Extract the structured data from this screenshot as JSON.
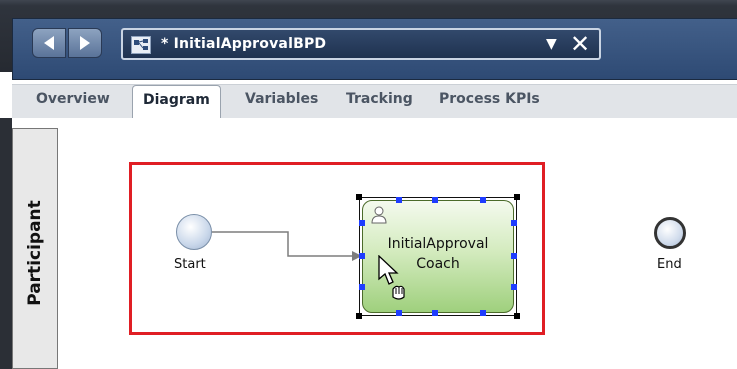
{
  "window": {
    "title": "* InitialApprovalBPD",
    "dropdown_glyph": "▼",
    "close_glyph": "✕",
    "back_icon": "left-arrow-icon",
    "forward_icon": "right-arrow-icon",
    "doc_icon": "process-diagram-icon"
  },
  "tabs": [
    {
      "label": "Overview",
      "active": false
    },
    {
      "label": "Diagram",
      "active": true
    },
    {
      "label": "Variables",
      "active": false
    },
    {
      "label": "Tracking",
      "active": false
    },
    {
      "label": "Process KPIs",
      "active": false
    }
  ],
  "diagram": {
    "lane_label": "Participant",
    "start_label": "Start",
    "task_label_line1": "InitialApproval",
    "task_label_line2": "Coach",
    "end_label": "End",
    "highlight_color": "#e01e24",
    "task_fill": "#b7e097",
    "handle_color": "#1e3cff"
  }
}
